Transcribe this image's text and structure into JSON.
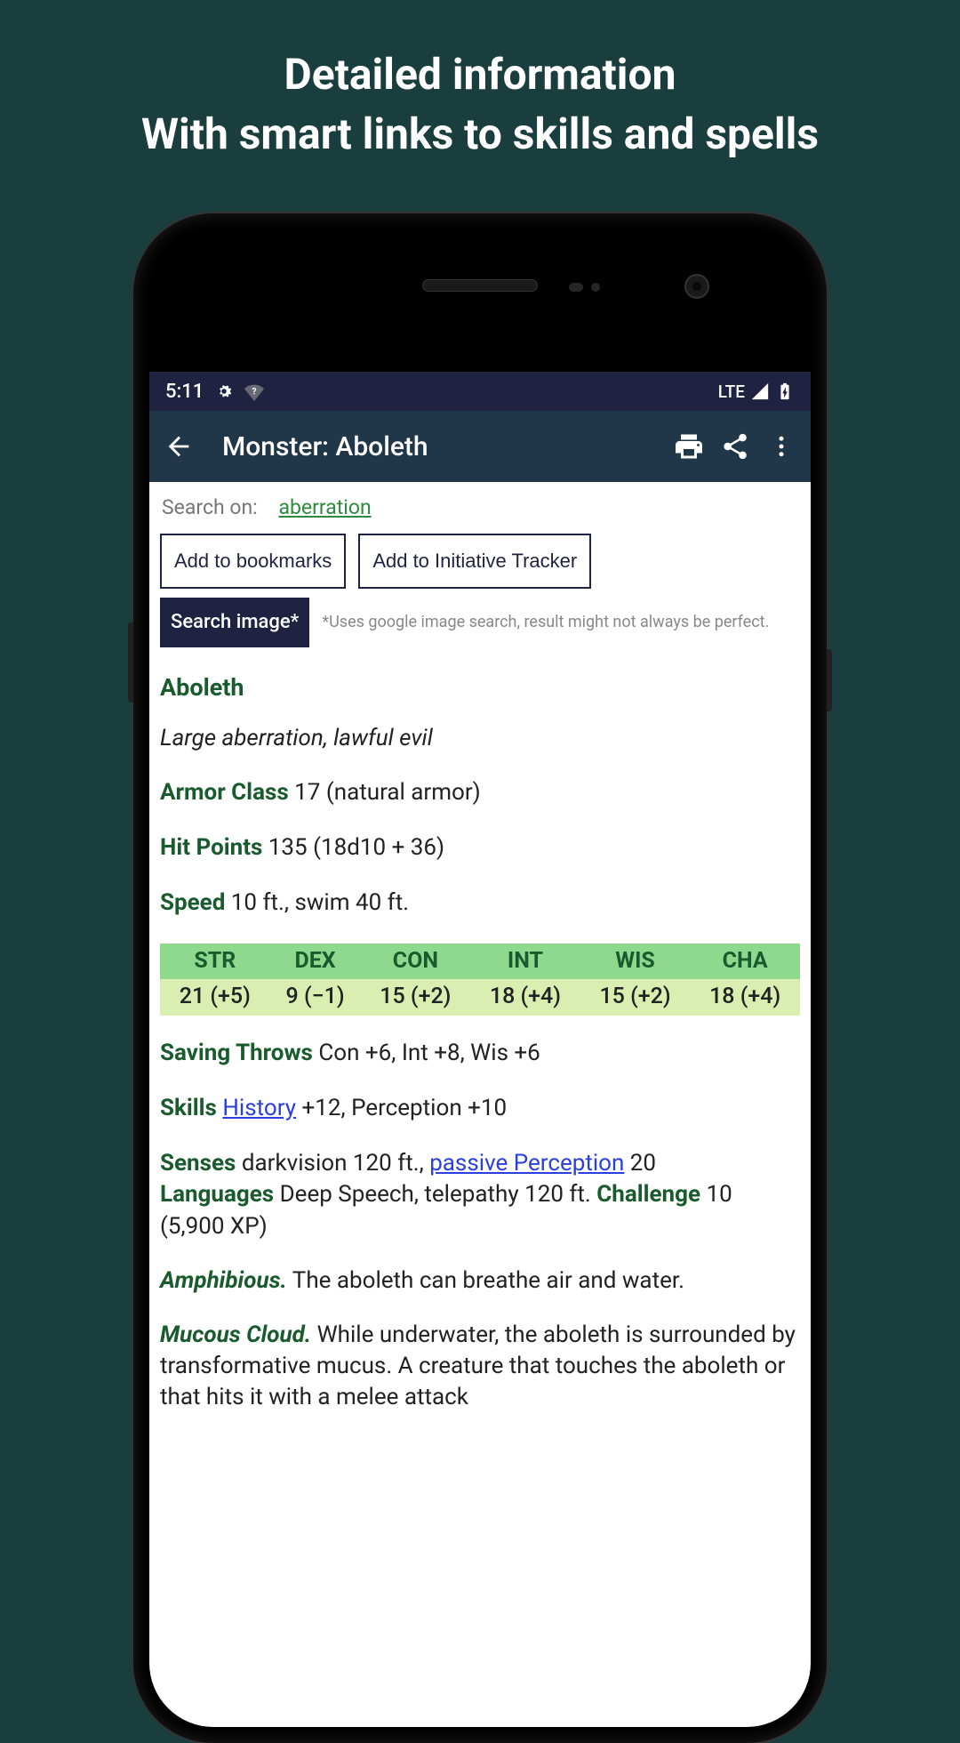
{
  "promo": {
    "line1": "Detailed information",
    "line2": "With smart links to skills and spells"
  },
  "statusbar": {
    "time": "5:11",
    "network": "LTE"
  },
  "appbar": {
    "title": "Monster: Aboleth"
  },
  "search_on": {
    "label": "Search on:",
    "link": "aberration"
  },
  "buttons": {
    "bookmark": "Add to bookmarks",
    "initiative": "Add to Initiative Tracker",
    "searchimg": "Search image*",
    "searchimg_note": "*Uses google image search, result might not always be perfect."
  },
  "monster": {
    "name": "Aboleth",
    "subtitle": "Large aberration, lawful evil",
    "ac_label": "Armor Class",
    "ac_value": " 17 (natural armor)",
    "hp_label": "Hit Points",
    "hp_value": " 135 (18d10 + 36)",
    "speed_label": "Speed",
    "speed_value": " 10 ft., swim 40 ft.",
    "abilities": {
      "headers": [
        "STR",
        "DEX",
        "CON",
        "INT",
        "WIS",
        "CHA"
      ],
      "values": [
        "21 (+5)",
        "9 (−1)",
        "15 (+2)",
        "18 (+4)",
        "15 (+2)",
        "18 (+4)"
      ]
    },
    "saves_label": "Saving Throws",
    "saves_value": " Con +6, Int +8, Wis +6",
    "skills_label": "Skills",
    "skills_link": "History",
    "skills_rest": " +12, Perception +10",
    "senses_label": "Senses",
    "senses_pre": " darkvision 120 ft., ",
    "senses_link": "passive Perception",
    "senses_post": " 20",
    "lang_label": "Languages",
    "lang_value": " Deep Speech, telepathy 120 ft. ",
    "chal_label": "Challenge",
    "chal_value": " 10 (5,900 XP)",
    "trait1_name": "Amphibious.",
    "trait1_text": " The aboleth can breathe air and water.",
    "trait2_name": "Mucous Cloud.",
    "trait2_text": " While underwater, the aboleth is surrounded by transformative mucus. A creature that touches the aboleth or that hits it with a melee attack"
  }
}
